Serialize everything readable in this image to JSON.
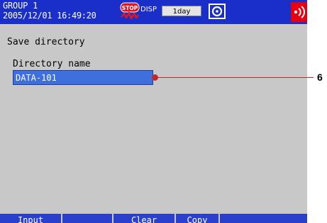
{
  "header": {
    "group_name": "GROUP 1",
    "datetime": "2005/12/01 16:49:20",
    "stop_icon_text": "STOP",
    "disp_label": "DISP",
    "period": "1day",
    "colors": {
      "bar": "#1a2fc9",
      "stop_icon": "#d9182a",
      "comm_icon": "#e60012"
    },
    "icons": [
      "stop-icon",
      "media-icon",
      "communication-icon"
    ]
  },
  "screen": {
    "title": "Save directory",
    "directory_label": "Directory name",
    "directory_value": "DATA-101",
    "colors": {
      "background": "#c8c8c8",
      "input_highlight": "#3e6fdc"
    }
  },
  "softkeys": [
    {
      "label": "Input"
    },
    {
      "label": ""
    },
    {
      "label": "Clear"
    },
    {
      "label": "Copy"
    },
    {
      "label": ""
    }
  ],
  "annotation": {
    "number": "6",
    "color": "#c1272d"
  }
}
